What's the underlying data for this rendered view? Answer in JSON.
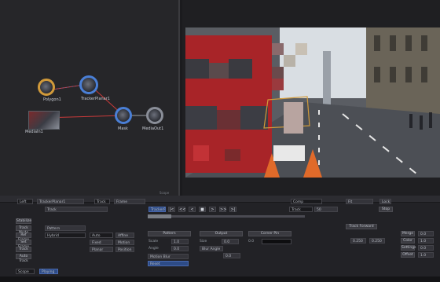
{
  "node_graph": {
    "nodes": [
      {
        "name": "MediaIn1",
        "label": "MediaIn1"
      },
      {
        "name": "Polygon1",
        "label": "Polygon1"
      },
      {
        "name": "TrackerPlanar1",
        "label": "TrackerPlanar1"
      },
      {
        "name": "MediaOut1",
        "label": "MediaOut1"
      },
      {
        "name": "Mask",
        "label": "Mask"
      }
    ],
    "scope_label": "Scope"
  },
  "viewer": {
    "image": "london-street-bus",
    "colors": {
      "sky": "#cfd6dc",
      "bus": "#b0282c",
      "road": "#4c4f55"
    }
  },
  "toolbar": {
    "left_field": "Left",
    "tracker_name": "TrackerPlanar1",
    "method": "Track",
    "frame_label": "Frame",
    "zoom": "Fit",
    "right_value": "Comp",
    "lock": "Lock"
  },
  "track_controls": {
    "operation_label": "Track",
    "range_label": "TrackerPlanar1",
    "buttons": [
      "|<",
      "<<",
      "<",
      "■",
      ">",
      ">>",
      ">|"
    ],
    "track_mode": "Track",
    "frame_value": "50",
    "end_value": "Stop"
  },
  "left_column": {
    "items": [
      "Stabilize",
      "Track Mode",
      "Ref Frame",
      "Set Frame",
      "Track",
      "Auto Track",
      "Remove"
    ],
    "values": [
      "Pattern",
      "Hybrid",
      "Auto",
      "Fixed",
      "Planar",
      "Affine",
      "Motion",
      "Position"
    ]
  },
  "center": {
    "headers": [
      "Pattern",
      "Output",
      "Corner Pin"
    ],
    "labels": [
      "Scale",
      "Angle",
      "Motion Blur",
      "Reset",
      "Size",
      "Blur Angle"
    ],
    "values": [
      "1.0",
      "0.0",
      "0.0",
      "0.0",
      "0.0"
    ]
  },
  "right": {
    "track_panel": "Track Forward",
    "steps": [
      "0.250",
      "0.250"
    ],
    "buttons": [
      "Merge",
      "Color",
      "Settings",
      "Offset"
    ],
    "values": [
      "0.0",
      "1.0",
      "0.0",
      "1.0"
    ]
  },
  "status": {
    "scope": "Scope",
    "state": "Playing"
  }
}
